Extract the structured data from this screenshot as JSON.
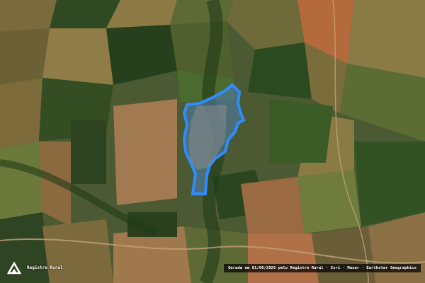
{
  "map": {
    "type": "satellite",
    "boundary_color": "#2f8cff",
    "fill_color": "#4f7fb3"
  },
  "branding": {
    "logo_text": "Registre Rural",
    "logo_icon": "registro-rural-logo-icon"
  },
  "attribution": {
    "text": "Gerada em 01/08/2026 pelo Registre Rural · Esri · Maxar · Earthstar Geographics"
  }
}
